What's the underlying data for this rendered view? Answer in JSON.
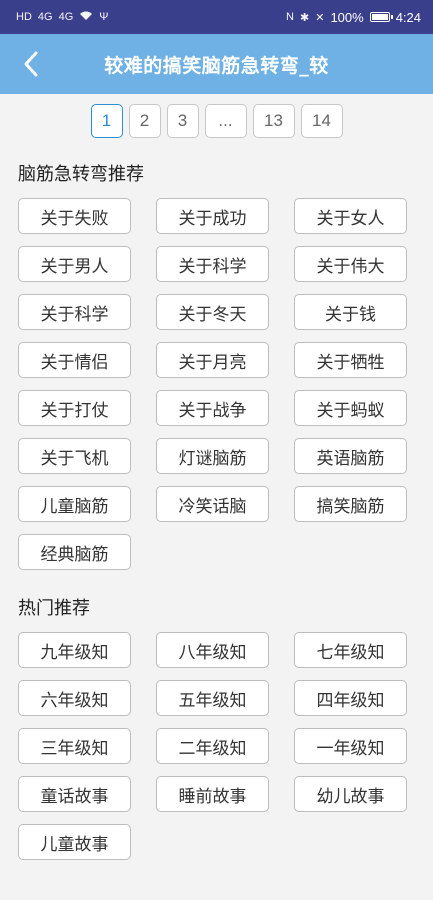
{
  "status_bar": {
    "left_icons": [
      "HD",
      "4G",
      "4G",
      "wifi-icon",
      "usb-icon"
    ],
    "battery": "100%",
    "time": "4:24"
  },
  "header": {
    "title": "较难的搞笑脑筋急转弯_较",
    "back_icon": "chevron-left-icon"
  },
  "pagination": {
    "pages": [
      "1",
      "2",
      "3",
      "...",
      "13",
      "14"
    ],
    "active": "1"
  },
  "sections": [
    {
      "title": "脑筋急转弯推荐",
      "items": [
        "关于失败",
        "关于成功",
        "关于女人",
        "关于男人",
        "关于科学",
        "关于伟大",
        "关于科学",
        "关于冬天",
        "关于钱",
        "关于情侣",
        "关于月亮",
        "关于牺牲",
        "关于打仗",
        "关于战争",
        "关于蚂蚁",
        "关于飞机",
        "灯谜脑筋",
        "英语脑筋",
        "儿童脑筋",
        "冷笑话脑",
        "搞笑脑筋",
        "经典脑筋"
      ]
    },
    {
      "title": "热门推荐",
      "items": [
        "九年级知",
        "八年级知",
        "七年级知",
        "六年级知",
        "五年级知",
        "四年级知",
        "三年级知",
        "二年级知",
        "一年级知",
        "童话故事",
        "睡前故事",
        "幼儿故事",
        "儿童故事"
      ]
    }
  ]
}
